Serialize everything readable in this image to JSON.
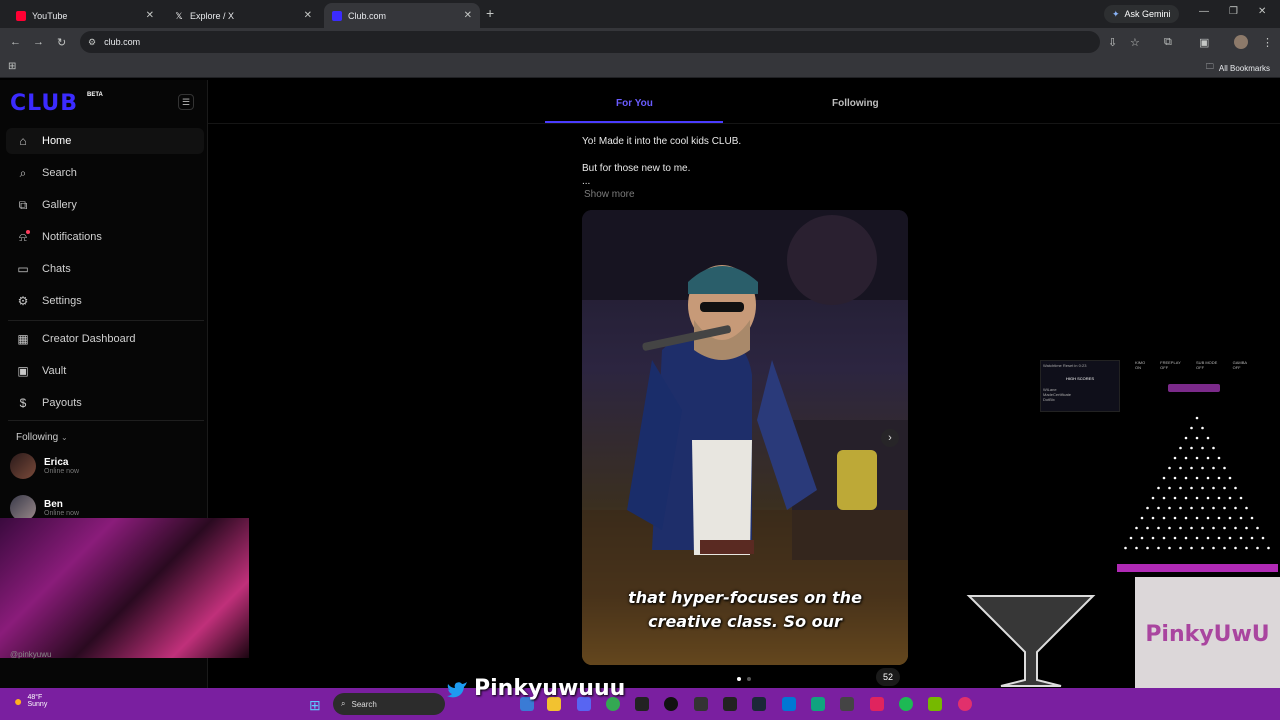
{
  "browser": {
    "tabs": [
      {
        "title": "YouTube",
        "favicon_color": "#ff0033"
      },
      {
        "title": "Explore / X",
        "favicon_color": "#ffffff"
      },
      {
        "title": "Club.com",
        "favicon_color": "#3b2bff",
        "active": true
      }
    ],
    "new_tab_label": "+",
    "gemini_label": "Ask Gemini",
    "url": "club.com",
    "bookmarks_label": "All Bookmarks"
  },
  "app": {
    "logo": "CLUB",
    "badge": "BETA",
    "nav": [
      {
        "label": "Home",
        "icon": "home-icon",
        "active": true
      },
      {
        "label": "Search",
        "icon": "search-icon"
      },
      {
        "label": "Gallery",
        "icon": "gallery-icon"
      },
      {
        "label": "Notifications",
        "icon": "bell-icon"
      },
      {
        "label": "Chats",
        "icon": "chat-icon"
      },
      {
        "label": "Settings",
        "icon": "gear-icon"
      }
    ],
    "creator_nav": [
      {
        "label": "Creator Dashboard",
        "icon": "dashboard-icon"
      },
      {
        "label": "Vault",
        "icon": "vault-icon"
      },
      {
        "label": "Payouts",
        "icon": "dollar-icon"
      }
    ],
    "following_header": "Following",
    "following": [
      {
        "name": "Erica",
        "status": "Online now"
      },
      {
        "name": "Ben",
        "status": "Online now"
      }
    ],
    "bottom_user": "@pinkyuwu"
  },
  "feed": {
    "tabs": [
      "For You",
      "Following"
    ],
    "active_tab": "For You",
    "post": {
      "line1": "Yo!  Made it into the cool kids CLUB.",
      "line2": "But for those new to me.",
      "ellipsis": "...",
      "show_more": "Show more",
      "caption_line1": "that hyper-focuses on the",
      "caption_line2": "creative class. So our",
      "next_arrow": "›",
      "count": "52"
    }
  },
  "overlay": {
    "hud_title": "Watchtime Reset in 0:23",
    "hud_header": "HIGH SCORES",
    "hud_rows": [
      "WiLane",
      "MadeCertificate",
      "DotBix"
    ],
    "stats": [
      "KIMO ON",
      "FREEPLAY OFF",
      "SUB MODE OFF",
      "GAMBA OFF"
    ],
    "brand": "PinkyUwU",
    "twitter_handle": "Pinkyuwuuu"
  },
  "taskbar": {
    "temperature": "48°F",
    "condition": "Sunny",
    "search_label": "Search"
  },
  "colors": {
    "brand": "#3b2bff",
    "taskbar": "#7a1fa0"
  }
}
